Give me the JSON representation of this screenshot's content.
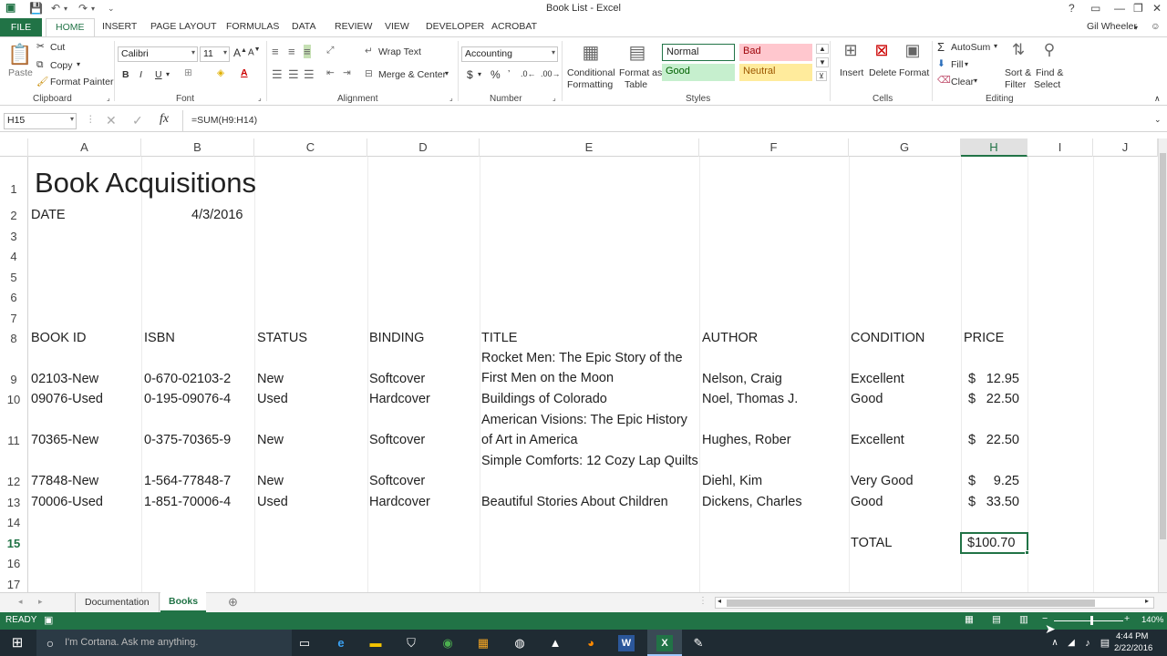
{
  "window": {
    "title": "Book List - Excel",
    "user": "Gil Wheeler",
    "help": "?"
  },
  "ribbon_tabs": [
    "FILE",
    "HOME",
    "INSERT",
    "PAGE LAYOUT",
    "FORMULAS",
    "DATA",
    "REVIEW",
    "VIEW",
    "DEVELOPER",
    "ACROBAT"
  ],
  "clipboard": {
    "paste": "Paste",
    "cut": "Cut",
    "copy": "Copy",
    "format_painter": "Format Painter",
    "group": "Clipboard"
  },
  "font": {
    "name": "Calibri",
    "size": "11",
    "bold": "B",
    "italic": "I",
    "underline": "U",
    "group": "Font"
  },
  "alignment": {
    "wrap": "Wrap Text",
    "merge": "Merge & Center",
    "group": "Alignment"
  },
  "number": {
    "format": "Accounting",
    "currency": "$",
    "percent": "%",
    "group": "Number"
  },
  "styles": {
    "conditional": [
      "Conditional",
      "Formatting"
    ],
    "format_table": [
      "Format as",
      "Table"
    ],
    "normal": "Normal",
    "bad": "Bad",
    "good": "Good",
    "neutral": "Neutral",
    "group": "Styles"
  },
  "cells": {
    "insert": "Insert",
    "delete": "Delete",
    "format": "Format",
    "group": "Cells"
  },
  "editing": {
    "autosum": "AutoSum",
    "fill": "Fill",
    "clear": "Clear",
    "sort": [
      "Sort &",
      "Filter"
    ],
    "find": [
      "Find &",
      "Select"
    ],
    "group": "Editing"
  },
  "formula_bar": {
    "name_box": "H15",
    "fx": "fx",
    "formula": "=SUM(H9:H14)"
  },
  "columns": [
    "A",
    "B",
    "C",
    "D",
    "E",
    "F",
    "G",
    "H",
    "I",
    "J"
  ],
  "rows": [
    "1",
    "2",
    "3",
    "4",
    "5",
    "6",
    "7",
    "8",
    "9",
    "10",
    "11",
    "12",
    "13",
    "14",
    "15",
    "16",
    "17"
  ],
  "sheet": {
    "title": "Book Acquisitions",
    "date_label": "DATE",
    "date_value": "4/3/2016",
    "headers": [
      "BOOK ID",
      "ISBN",
      "STATUS",
      "BINDING",
      "TITLE",
      "AUTHOR",
      "CONDITION",
      "PRICE"
    ],
    "records": [
      {
        "id": "02103-New",
        "isbn": "0-670-02103-2",
        "status": "New",
        "binding": "Softcover",
        "title": "Rocket Men: The Epic Story of the First Men on the Moon",
        "author": "Nelson, Craig",
        "condition": "Excellent",
        "price": "12.95"
      },
      {
        "id": "09076-Used",
        "isbn": "0-195-09076-4",
        "status": "Used",
        "binding": "Hardcover",
        "title": "Buildings of Colorado",
        "author": "Noel, Thomas J.",
        "condition": "Good",
        "price": "22.50"
      },
      {
        "id": "70365-New",
        "isbn": "0-375-70365-9",
        "status": "New",
        "binding": "Softcover",
        "title": "American Visions: The Epic History of Art in America",
        "author": "Hughes, Rober",
        "condition": "Excellent",
        "price": "22.50"
      },
      {
        "id": "77848-New",
        "isbn": "1-564-77848-7",
        "status": "New",
        "binding": "Softcover",
        "title": "Simple Comforts: 12 Cozy Lap Quilts",
        "author": "Diehl, Kim",
        "condition": "Very Good",
        "price": "9.25"
      },
      {
        "id": "70006-Used",
        "isbn": "1-851-70006-4",
        "status": "Used",
        "binding": "Hardcover",
        "title": "Beautiful Stories About Children",
        "author": "Dickens, Charles",
        "condition": "Good",
        "price": "33.50"
      }
    ],
    "currency_symbol": "$",
    "total_label": "TOTAL",
    "total_value": "$100.70"
  },
  "sheet_tabs": [
    "Documentation",
    "Books"
  ],
  "status": {
    "ready": "READY",
    "zoom": "140%"
  },
  "taskbar": {
    "cortana": "I'm Cortana. Ask me anything.",
    "time": "4:44 PM",
    "date": "2/22/2016"
  },
  "colors": {
    "excel_green": "#217346",
    "bad_bg": "#ffc7ce",
    "bad_fg": "#9c0006",
    "good_bg": "#c6efce",
    "good_fg": "#006100",
    "neutral_bg": "#ffeb9c",
    "neutral_fg": "#9c5700"
  }
}
